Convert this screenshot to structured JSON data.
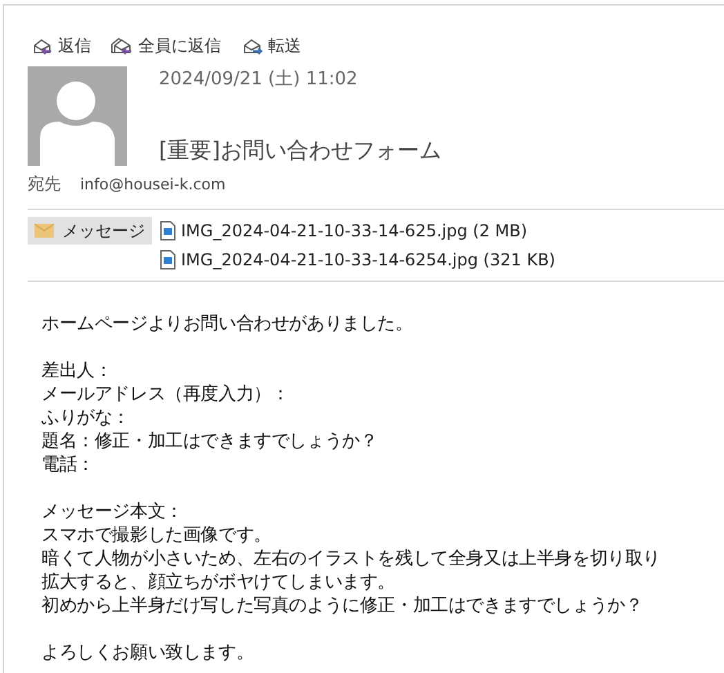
{
  "toolbar": [
    {
      "kind": "reply",
      "label": "返信"
    },
    {
      "kind": "reply-all",
      "label": "全員に返信"
    },
    {
      "kind": "forward",
      "label": "転送"
    }
  ],
  "header": {
    "date": "2024/09/21 (土) 11:02",
    "subject": "[重要]お問い合わせフォーム",
    "to_label": "宛先",
    "to": "info@housei-k.com"
  },
  "attachments": {
    "message_tab": {
      "label": "メッセージ",
      "selected": true
    },
    "files": [
      {
        "name": "IMG_2024-04-21-10-33-14-625.jpg (2 MB)"
      },
      {
        "name": "IMG_2024-04-21-10-33-14-6254.jpg (321 KB)"
      }
    ]
  },
  "body": [
    [
      "ホームページよりお問い合わせがありました。"
    ],
    [
      "差出人：",
      "メールアドレス（再度入力）：",
      "ふりがな：",
      "題名：修正・加工はできますでしょうか？",
      "電話："
    ],
    [
      "メッセージ本文：",
      "スマホで撮影した画像です。",
      "暗くて人物が小さいため、左右のイラストを残して全身又は上半身を切り取り",
      "拡大すると、顔立ちがボヤけてしまいます。",
      "初めから上半身だけ写した写真のように修正・加工はできますでしょうか？"
    ],
    [
      "よろしくお願い致します。"
    ]
  ]
}
